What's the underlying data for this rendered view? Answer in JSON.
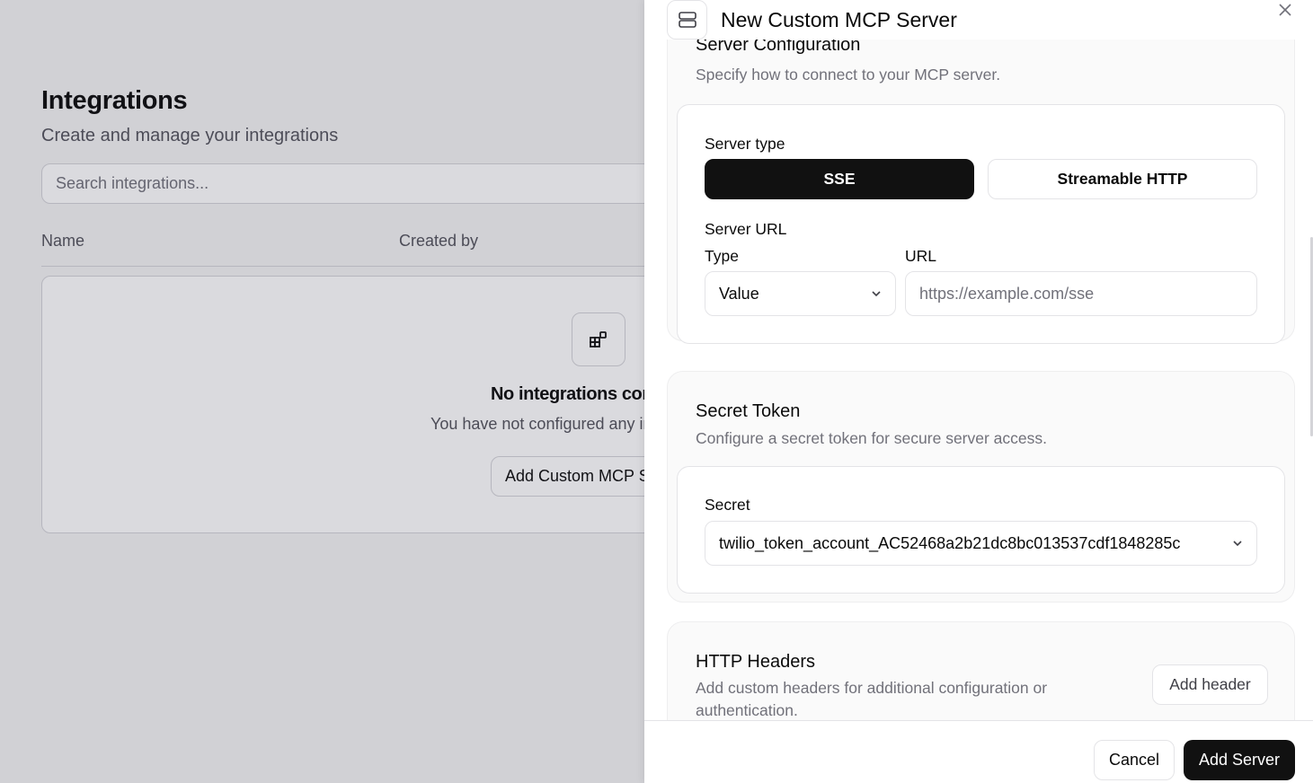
{
  "background": {
    "title": "Integrations",
    "subtitle": "Create and manage your integrations",
    "search_placeholder": "Search integrations...",
    "columns": [
      "Name",
      "Created by"
    ],
    "empty_state": {
      "title": "No integrations configured",
      "description": "You have not configured any integrations yet.",
      "button_label": "Add Custom MCP Server",
      "icon": "widgets-icon"
    }
  },
  "drawer": {
    "title": "New Custom MCP Server",
    "header_icon": "server-icon",
    "close_icon": "close-icon",
    "server_config": {
      "title": "Server Configuration",
      "description": "Specify how to connect to your MCP server.",
      "server_type_label": "Server type",
      "server_type_options": [
        "SSE",
        "Streamable HTTP"
      ],
      "server_type_selected": "SSE",
      "server_url_label": "Server URL",
      "type_label": "Type",
      "type_value": "Value",
      "url_label": "URL",
      "url_placeholder": "https://example.com/sse"
    },
    "secret_token": {
      "title": "Secret Token",
      "description": "Configure a secret token for secure server access.",
      "secret_label": "Secret",
      "secret_value": "twilio_token_account_AC52468a2b21dc8bc013537cdf1848285c"
    },
    "http_headers": {
      "title": "HTTP Headers",
      "description_line1": "Add custom headers for additional configuration or",
      "description_line2": "authentication.",
      "add_header_label": "Add header"
    },
    "footer": {
      "cancel_label": "Cancel",
      "submit_label": "Add Server"
    }
  },
  "colors": {
    "primary": "#111111",
    "muted_text": "#71717a",
    "border": "#e4e4e7",
    "section_bg": "#fafafa"
  }
}
